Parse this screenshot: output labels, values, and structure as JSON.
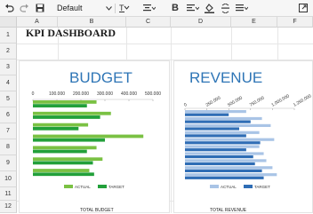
{
  "toolbar": {
    "font_name": "Default",
    "icons": [
      "undo-icon",
      "redo-icon",
      "save-icon",
      "chevron-down-icon",
      "text-color-icon",
      "align-center-icon",
      "bold-icon",
      "align-icon",
      "fill-color-icon",
      "spacing-icon",
      "more-icon",
      "expand-icon"
    ]
  },
  "sheet": {
    "columns": [
      "A",
      "B",
      "C",
      "D",
      "E",
      "F"
    ],
    "rows": [
      "1",
      "2",
      "3",
      "4",
      "5",
      "6",
      "7",
      "8",
      "9",
      "10",
      "11",
      "12"
    ],
    "title": "KPI DASHBOARD"
  },
  "colors": {
    "budget_actual": "#7ac143",
    "budget_target": "#22a03a",
    "revenue_actual": "#a9c4e6",
    "revenue_target": "#2f6db5",
    "title_blue": "#2e75b6"
  },
  "chart_data": [
    {
      "type": "bar",
      "orientation": "horizontal",
      "title": "BUDGET",
      "xlim": [
        0,
        500000
      ],
      "x_ticks": [
        "0",
        "100.000",
        "200.000",
        "300.000",
        "400.000",
        "500.000"
      ],
      "series": [
        {
          "name": "ACTUAL",
          "values": [
            265000,
            325000,
            230000,
            460000,
            265000,
            290000,
            235000
          ]
        },
        {
          "name": "TARGET",
          "values": [
            225000,
            280000,
            190000,
            300000,
            225000,
            250000,
            255000
          ]
        }
      ],
      "legend": "bottom",
      "footer": "TOTAL BUDGET"
    },
    {
      "type": "bar",
      "orientation": "horizontal",
      "title": "REVENUE",
      "xlim": [
        0,
        1250000
      ],
      "x_ticks": [
        "0",
        "250.000",
        "500.000",
        "750.000",
        "1.000.000",
        "1.250.000"
      ],
      "series": [
        {
          "name": "ACTUAL",
          "values": [
            700000,
            880000,
            980000,
            850000,
            1020000,
            850000,
            900000,
            930000,
            1000000,
            1050000
          ]
        },
        {
          "name": "TARGET",
          "values": [
            500000,
            750000,
            620000,
            700000,
            860000,
            700000,
            780000,
            800000,
            880000,
            900000
          ]
        }
      ],
      "legend": "bottom",
      "footer": "TOTAL REVENUE"
    }
  ]
}
